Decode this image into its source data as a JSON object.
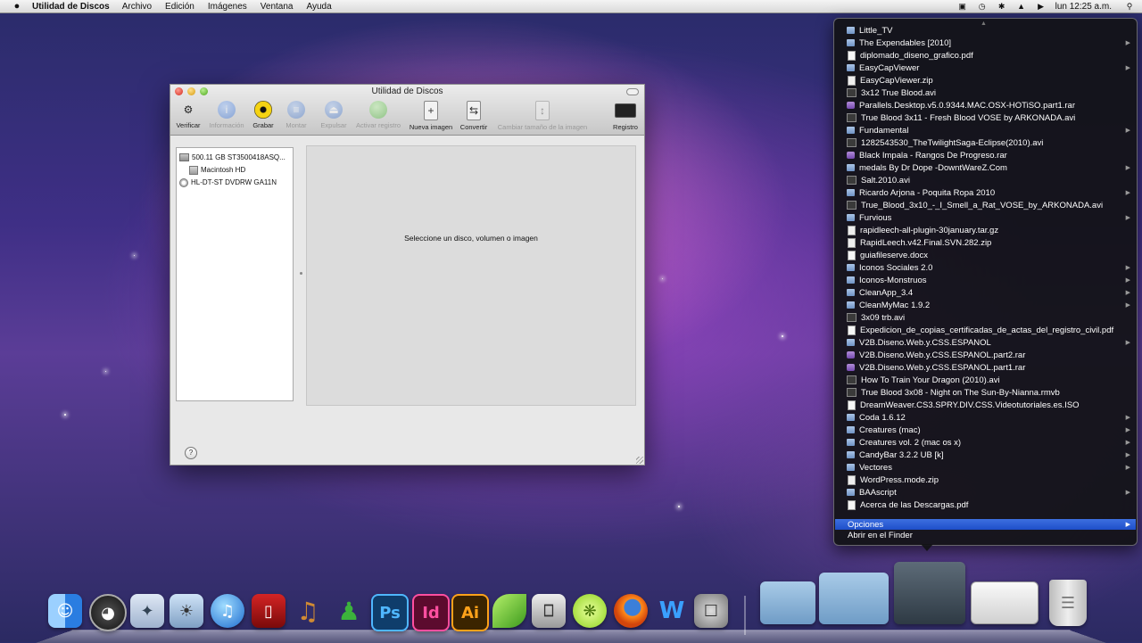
{
  "menubar": {
    "apple": "",
    "app": "Utilidad de Discos",
    "items": [
      "Archivo",
      "Edición",
      "Imágenes",
      "Ventana",
      "Ayuda"
    ],
    "clock": "lun 12:25 a.m."
  },
  "window": {
    "title": "Utilidad de Discos",
    "toolbar": {
      "verificar": "Verificar",
      "informacion": "Información",
      "grabar": "Grabar",
      "montar": "Montar",
      "expulsar": "Expulsar",
      "activar": "Activar registro",
      "nueva": "Nueva imagen",
      "convertir": "Convertir",
      "cambiar": "Cambiar tamaño de la imagen",
      "registro": "Registro"
    },
    "sidebar": {
      "disk": "500.11 GB ST3500418ASQ...",
      "volume": "Macintosh HD",
      "dvd": "HL-DT-ST DVDRW GA11N"
    },
    "detail_message": "Seleccione un disco, volumen o imagen",
    "help": "?"
  },
  "stack": {
    "items": [
      "Little_TV",
      "The Expendables [2010]",
      "diplomado_diseno_grafico.pdf",
      "EasyCapViewer",
      "EasyCapViewer.zip",
      "3x12 True Blood.avi",
      "Parallels.Desktop.v5.0.9344.MAC.OSX-HOTiSO.part1.rar",
      "True Blood 3x11 - Fresh Blood VOSE by ARKONADA.avi",
      "Fundamental",
      "1282543530_TheTwilightSaga-Eclipse(2010).avi",
      "Black Impala - Rangos De Progreso.rar",
      "medals By Dr Dope -DowntWareZ.Com",
      "Salt.2010.avi",
      "Ricardo Arjona - Poquita Ropa 2010",
      "True_Blood_3x10_-_I_Smell_a_Rat_VOSE_by_ARKONADA.avi",
      "Furvious",
      "rapidleech-all-plugin-30january.tar.gz",
      "RapidLeech.v42.Final.SVN.282.zip",
      "guiafileserve.docx",
      "Iconos Sociales 2.0",
      "Iconos-Monstruos",
      "CleanApp_3.4",
      "CleanMyMac 1.9.2",
      "3x09 trb.avi",
      "Expedicion_de_copias_certificadas_de_actas_del_registro_civil.pdf",
      "V2B.Diseno.Web.y.CSS.ESPANOL",
      "V2B.Diseno.Web.y.CSS.ESPANOL.part2.rar",
      "V2B.Diseno.Web.y.CSS.ESPANOL.part1.rar",
      "How To Train Your Dragon (2010).avi",
      "True Blood 3x08 - Night on The Sun-By-Nianna.rmvb",
      "DreamWeaver.CS3.SPRY.DIV.CSS.Videotutoriales.es.ISO",
      "Coda 1.6.12",
      "Creatures (mac)",
      "Creatures vol. 2 (mac os x)",
      "CandyBar 3.2.2 UB [k]",
      "Vectores",
      "WordPress.mode.zip",
      "BAAscript",
      "Acerca de las Descargas.pdf"
    ],
    "options": "Opciones",
    "open_in_finder": "Abrir en el Finder"
  },
  "dock": {
    "ps": "Ps",
    "id": "Id",
    "ai": "Ai"
  }
}
